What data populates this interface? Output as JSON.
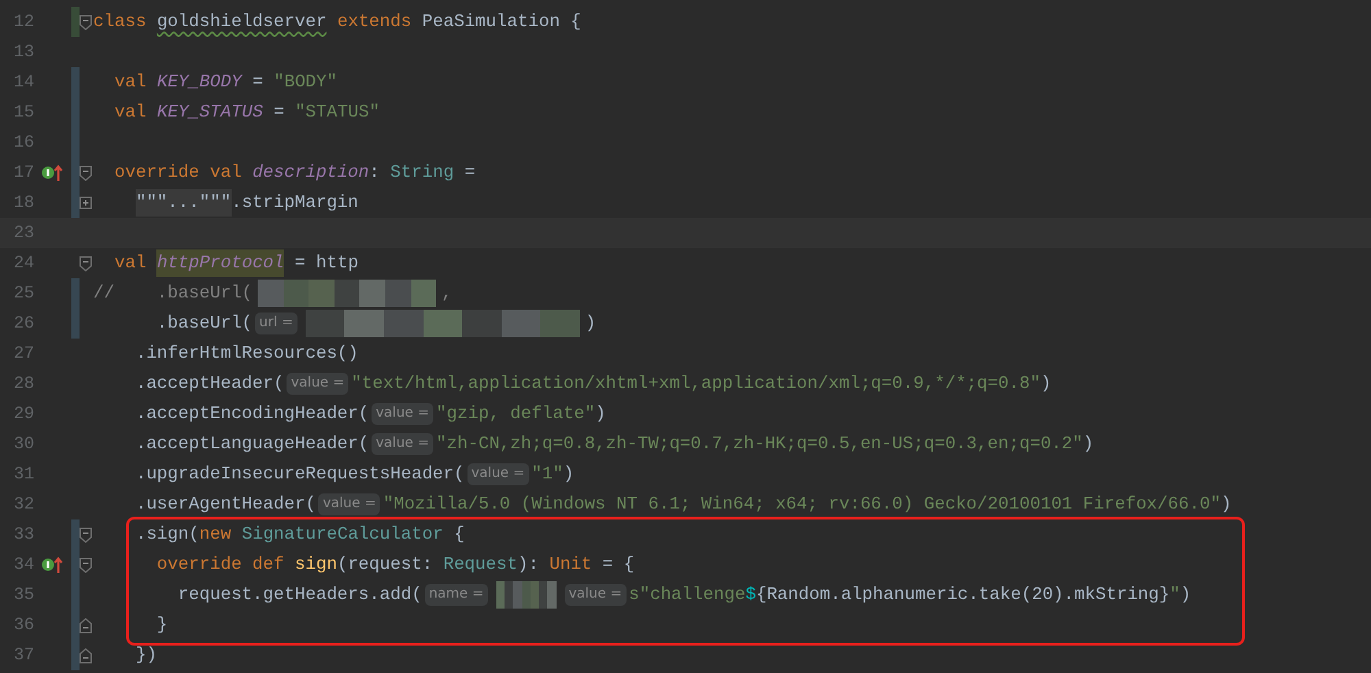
{
  "editor": {
    "lines": [
      {
        "number": "12",
        "added": true,
        "foldable": true,
        "tokens": [
          {
            "kind": "keyword",
            "text": "class "
          },
          {
            "kind": "plain",
            "text": "goldshieldserver",
            "warning": true
          },
          {
            "kind": "keyword",
            "text": " extends "
          },
          {
            "kind": "plain",
            "text": "PeaSimulation {"
          }
        ]
      },
      {
        "number": "13"
      },
      {
        "number": "14",
        "modified": true,
        "tokens": [
          {
            "kind": "keyword",
            "text": "  val "
          },
          {
            "kind": "field",
            "text": "KEY_BODY"
          },
          {
            "kind": "plain",
            "text": " = "
          },
          {
            "kind": "string",
            "text": "\"BODY\""
          }
        ]
      },
      {
        "number": "15",
        "modified": true,
        "tokens": [
          {
            "kind": "keyword",
            "text": "  val "
          },
          {
            "kind": "field",
            "text": "KEY_STATUS"
          },
          {
            "kind": "plain",
            "text": " = "
          },
          {
            "kind": "string",
            "text": "\"STATUS\""
          }
        ]
      },
      {
        "number": "16",
        "modified": true
      },
      {
        "number": "17",
        "modified": true,
        "foldable": true,
        "overrides": true,
        "tokens": [
          {
            "kind": "keyword",
            "text": "  override val "
          },
          {
            "kind": "field",
            "text": "description"
          },
          {
            "kind": "plain",
            "text": ": "
          },
          {
            "kind": "type",
            "text": "String"
          },
          {
            "kind": "plain",
            "text": " ="
          }
        ]
      },
      {
        "number": "18",
        "modified": true,
        "folded": true,
        "tokens": [
          {
            "kind": "folded",
            "text": "    \"\"\"...\"\"\""
          },
          {
            "kind": "plain",
            "text": ".stripMargin"
          }
        ]
      },
      {
        "number": "23",
        "current": true
      },
      {
        "number": "24",
        "foldable": true,
        "tokens": [
          {
            "kind": "keyword",
            "text": "  val "
          },
          {
            "kind": "field",
            "text": "httpProtocol",
            "marked": true
          },
          {
            "kind": "plain",
            "text": " = http"
          }
        ]
      },
      {
        "number": "25",
        "modified": true,
        "tokens": [
          {
            "kind": "comment",
            "text": "//    .baseUrl("
          },
          {
            "kind": "redacted"
          },
          {
            "kind": "comment",
            "text": ","
          }
        ]
      },
      {
        "number": "26",
        "modified": true,
        "tokens": [
          {
            "kind": "plain",
            "text": "      .baseUrl("
          },
          {
            "kind": "hint",
            "text": "url ="
          },
          {
            "kind": "redacted"
          },
          {
            "kind": "plain",
            "text": ")"
          }
        ]
      },
      {
        "number": "27",
        "tokens": [
          {
            "kind": "plain",
            "text": "    .inferHtmlResources()"
          }
        ]
      },
      {
        "number": "28",
        "tokens": [
          {
            "kind": "plain",
            "text": "    .acceptHeader("
          },
          {
            "kind": "hint",
            "text": "value ="
          },
          {
            "kind": "string",
            "text": "\"text/html,application/xhtml+xml,application/xml;q=0.9,*/*;q=0.8\""
          },
          {
            "kind": "plain",
            "text": ")"
          }
        ]
      },
      {
        "number": "29",
        "tokens": [
          {
            "kind": "plain",
            "text": "    .acceptEncodingHeader("
          },
          {
            "kind": "hint",
            "text": "value ="
          },
          {
            "kind": "string",
            "text": "\"gzip, deflate\""
          },
          {
            "kind": "plain",
            "text": ")"
          }
        ]
      },
      {
        "number": "30",
        "tokens": [
          {
            "kind": "plain",
            "text": "    .acceptLanguageHeader("
          },
          {
            "kind": "hint",
            "text": "value ="
          },
          {
            "kind": "string",
            "text": "\"zh-CN,zh;q=0.8,zh-TW;q=0.7,zh-HK;q=0.5,en-US;q=0.3,en;q=0.2\""
          },
          {
            "kind": "plain",
            "text": ")"
          }
        ]
      },
      {
        "number": "31",
        "tokens": [
          {
            "kind": "plain",
            "text": "    .upgradeInsecureRequestsHeader("
          },
          {
            "kind": "hint",
            "text": "value ="
          },
          {
            "kind": "string",
            "text": "\"1\""
          },
          {
            "kind": "plain",
            "text": ")"
          }
        ]
      },
      {
        "number": "32",
        "tokens": [
          {
            "kind": "plain",
            "text": "    .userAgentHeader("
          },
          {
            "kind": "hint",
            "text": "value ="
          },
          {
            "kind": "string",
            "text": "\"Mozilla/5.0 (Windows NT 6.1; Win64; x64; rv:66.0) Gecko/20100101 Firefox/66.0\""
          },
          {
            "kind": "plain",
            "text": ")"
          }
        ]
      },
      {
        "number": "33",
        "modified": true,
        "foldable": true,
        "highlighted": true,
        "tokens": [
          {
            "kind": "plain",
            "text": "    .sign("
          },
          {
            "kind": "keyword",
            "text": "new "
          },
          {
            "kind": "type",
            "text": "SignatureCalculator"
          },
          {
            "kind": "plain",
            "text": " {"
          }
        ]
      },
      {
        "number": "34",
        "modified": true,
        "foldable": true,
        "overrides": true,
        "highlighted": true,
        "tokens": [
          {
            "kind": "keyword",
            "text": "      override def "
          },
          {
            "kind": "method",
            "text": "sign"
          },
          {
            "kind": "plain",
            "text": "(request: "
          },
          {
            "kind": "type",
            "text": "Request"
          },
          {
            "kind": "plain",
            "text": "): "
          },
          {
            "kind": "keyword",
            "text": "Unit"
          },
          {
            "kind": "plain",
            "text": " = {"
          }
        ]
      },
      {
        "number": "35",
        "modified": true,
        "highlighted": true,
        "tokens": [
          {
            "kind": "plain",
            "text": "        request.getHeaders.add("
          },
          {
            "kind": "hint",
            "text": "name ="
          },
          {
            "kind": "redacted"
          },
          {
            "kind": "hint",
            "text": "value ="
          },
          {
            "kind": "string",
            "text": "s\"challenge"
          },
          {
            "kind": "template",
            "text": "$"
          },
          {
            "kind": "plain",
            "text": "{Random.alphanumeric.take(20).mkString}"
          },
          {
            "kind": "string",
            "text": "\""
          },
          {
            "kind": "plain",
            "text": ")"
          }
        ]
      },
      {
        "number": "36",
        "modified": true,
        "fold_end": true,
        "highlighted": true,
        "tokens": [
          {
            "kind": "plain",
            "text": "      }"
          }
        ]
      },
      {
        "number": "37",
        "modified": true,
        "fold_end": true,
        "tokens": [
          {
            "kind": "plain",
            "text": "    })"
          }
        ]
      }
    ]
  }
}
